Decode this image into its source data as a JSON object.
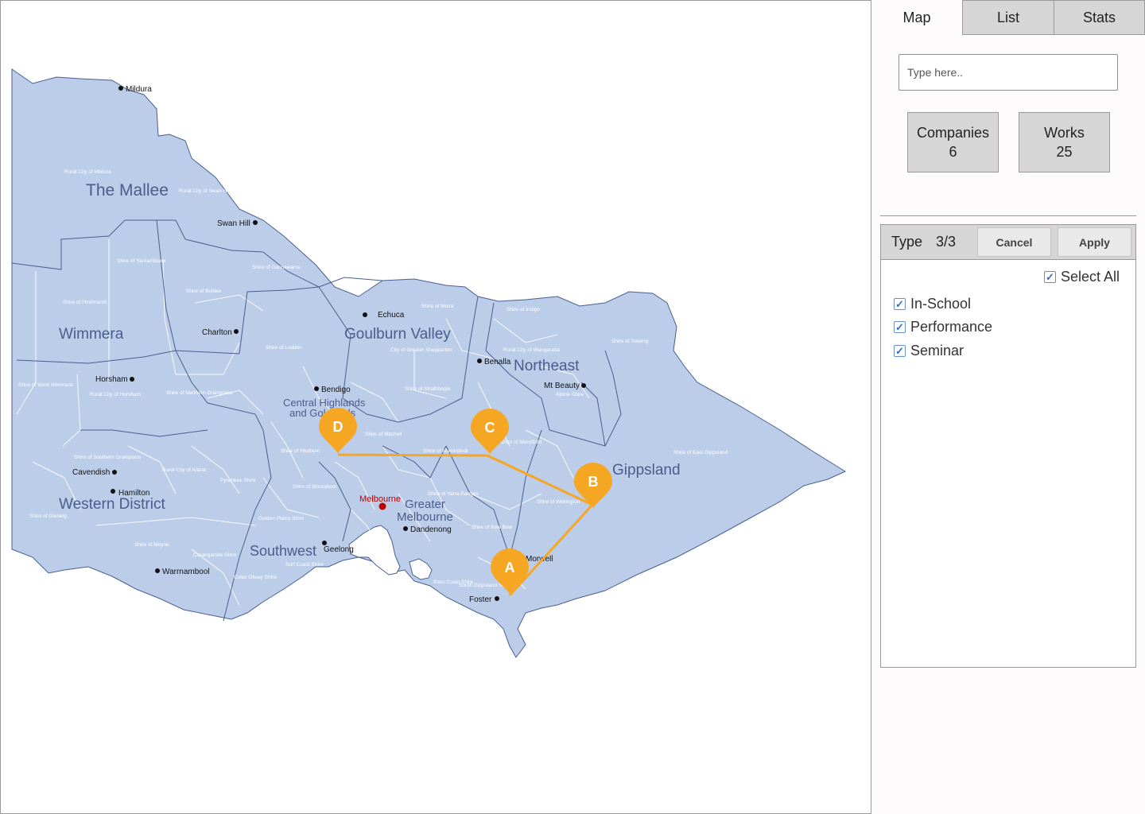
{
  "tabs": [
    {
      "label": "Map",
      "active": true
    },
    {
      "label": "List",
      "active": false
    },
    {
      "label": "Stats",
      "active": false
    }
  ],
  "search": {
    "placeholder": "Type here..",
    "value": ""
  },
  "stats": {
    "companies": {
      "label": "Companies",
      "value": "6"
    },
    "works": {
      "label": "Works",
      "value": "25"
    }
  },
  "filter": {
    "title": "Type",
    "count": "3/3",
    "cancel_label": "Cancel",
    "apply_label": "Apply",
    "select_all_label": "Select All",
    "select_all_checked": true,
    "options": [
      {
        "label": "In-School",
        "checked": true
      },
      {
        "label": "Performance",
        "checked": true
      },
      {
        "label": "Seminar",
        "checked": true
      }
    ]
  },
  "map": {
    "colors": {
      "land": "#bccde9",
      "border": "#4a5f8f",
      "route": "#f5a623",
      "marker": "#f5a623",
      "region_label": "#4a5c8c",
      "melbourne": "#c00000"
    },
    "regions": {
      "mallee": "The Mallee",
      "wimmera": "Wimmera",
      "goulburn": "Goulburn Valley",
      "northeast": "Northeast",
      "central1": "Central Highlands",
      "central2": "and Goldfields",
      "gippsland": "Gippsland",
      "western": "Western District",
      "southwest": "Southwest",
      "greater1": "Greater",
      "greater2": "Melbourne"
    },
    "cities": {
      "mildura": "Mildura",
      "swanhill": "Swan Hill",
      "echuca": "Echuca",
      "charlton": "Charlton",
      "benalla": "Benalla",
      "horsham": "Horsham",
      "bendigo": "Bendigo",
      "mtbeauty": "Mt Beauty",
      "cavendish": "Cavendish",
      "hamilton": "Hamilton",
      "melbourne": "Melbourne",
      "dandenong": "Dandenong",
      "geelong": "Geelong",
      "warrnambool": "Warrnambool",
      "morwell": "Morwell",
      "foster": "Foster"
    },
    "shires": {
      "s1": "Rural City of Mildura",
      "s2": "Rural City of Swan Hill",
      "s3": "Shire of Yarriambiack",
      "s4": "Shire of Buloke",
      "s5": "Shire of Gannawarra",
      "s6": "Shire of Hindmarsh",
      "s7": "Shire of Loddon",
      "s8": "Shire of Moira",
      "s9": "Rural City of Wangaratta",
      "s10": "City of Greater Shepparton",
      "s11": "Shire of Towong",
      "s12": "Shire of West Wimmera",
      "s13": "Rural City of Horsham",
      "s14": "Shire of Northern Grampians",
      "s15": "Shire of Strathbogie",
      "s16": "Shire of Mitchell",
      "s17": "Shire of Murrindindi",
      "s18": "Shire of Mansfield",
      "s19": "Shire of East Gippsland",
      "s20": "Shire of Southern Grampians",
      "s21": "Rural City of Ararat",
      "s22": "Pyrenees Shire",
      "s23": "Shire of Hepburn",
      "s24": "Shire of Moorabool",
      "s25": "Shire of Yarra Ranges",
      "s26": "Shire of Wellington",
      "s27": "Shire of Glenelg",
      "s28": "Shire of Moyne",
      "s29": "Golden Plains Shire",
      "s30": "Shire of Baw Baw",
      "s31": "Corangamite Shire",
      "s32": "Colac Otway Shire",
      "s33": "Surf Coast Shire",
      "s34": "South Gippsland Shire",
      "s35": "Bass Coast Shire",
      "s36": "Alpine Shire",
      "s37": "Shire of Indigo"
    },
    "markers": [
      "A",
      "B",
      "C",
      "D"
    ]
  }
}
